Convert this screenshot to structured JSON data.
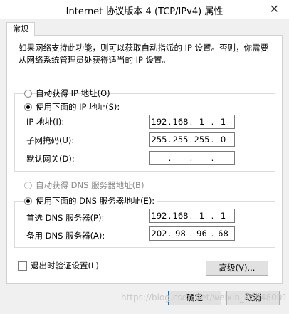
{
  "window": {
    "title": "Internet 协议版本 4 (TCP/IPv4) 属性",
    "close_glyph": "✕"
  },
  "tab": {
    "label": "常规"
  },
  "description": "如果网络支持此功能，则可以获取自动指派的 IP 设置。否则，你需要从网络系统管理员处获得适当的 IP 设置。",
  "ip_section": {
    "auto_label": "自动获得 IP 地址(O)",
    "manual_label": "使用下面的 IP 地址(S):",
    "selected": "manual",
    "fields": [
      {
        "label": "IP 地址(I):",
        "octets": [
          "192",
          "168",
          "1",
          "1"
        ]
      },
      {
        "label": "子网掩码(U):",
        "octets": [
          "255",
          "255",
          "255",
          "0"
        ]
      },
      {
        "label": "默认网关(D):",
        "octets": [
          "",
          "",
          "",
          ""
        ]
      }
    ]
  },
  "dns_section": {
    "auto_label": "自动获得 DNS 服务器地址(B)",
    "manual_label": "使用下面的 DNS 服务器地址(E):",
    "selected": "manual",
    "fields": [
      {
        "label": "首选 DNS 服务器(P):",
        "octets": [
          "192",
          "168",
          "1",
          "1"
        ]
      },
      {
        "label": "备用 DNS 服务器(A):",
        "octets": [
          "202",
          "98",
          "96",
          "68"
        ]
      }
    ]
  },
  "validate_checkbox": {
    "label": "退出时验证设置(L)",
    "checked": false
  },
  "buttons": {
    "advanced": "高级(V)...",
    "ok": "确定",
    "cancel": "取消"
  },
  "watermark": "https://blog.csdn.net/weixin_45848001"
}
